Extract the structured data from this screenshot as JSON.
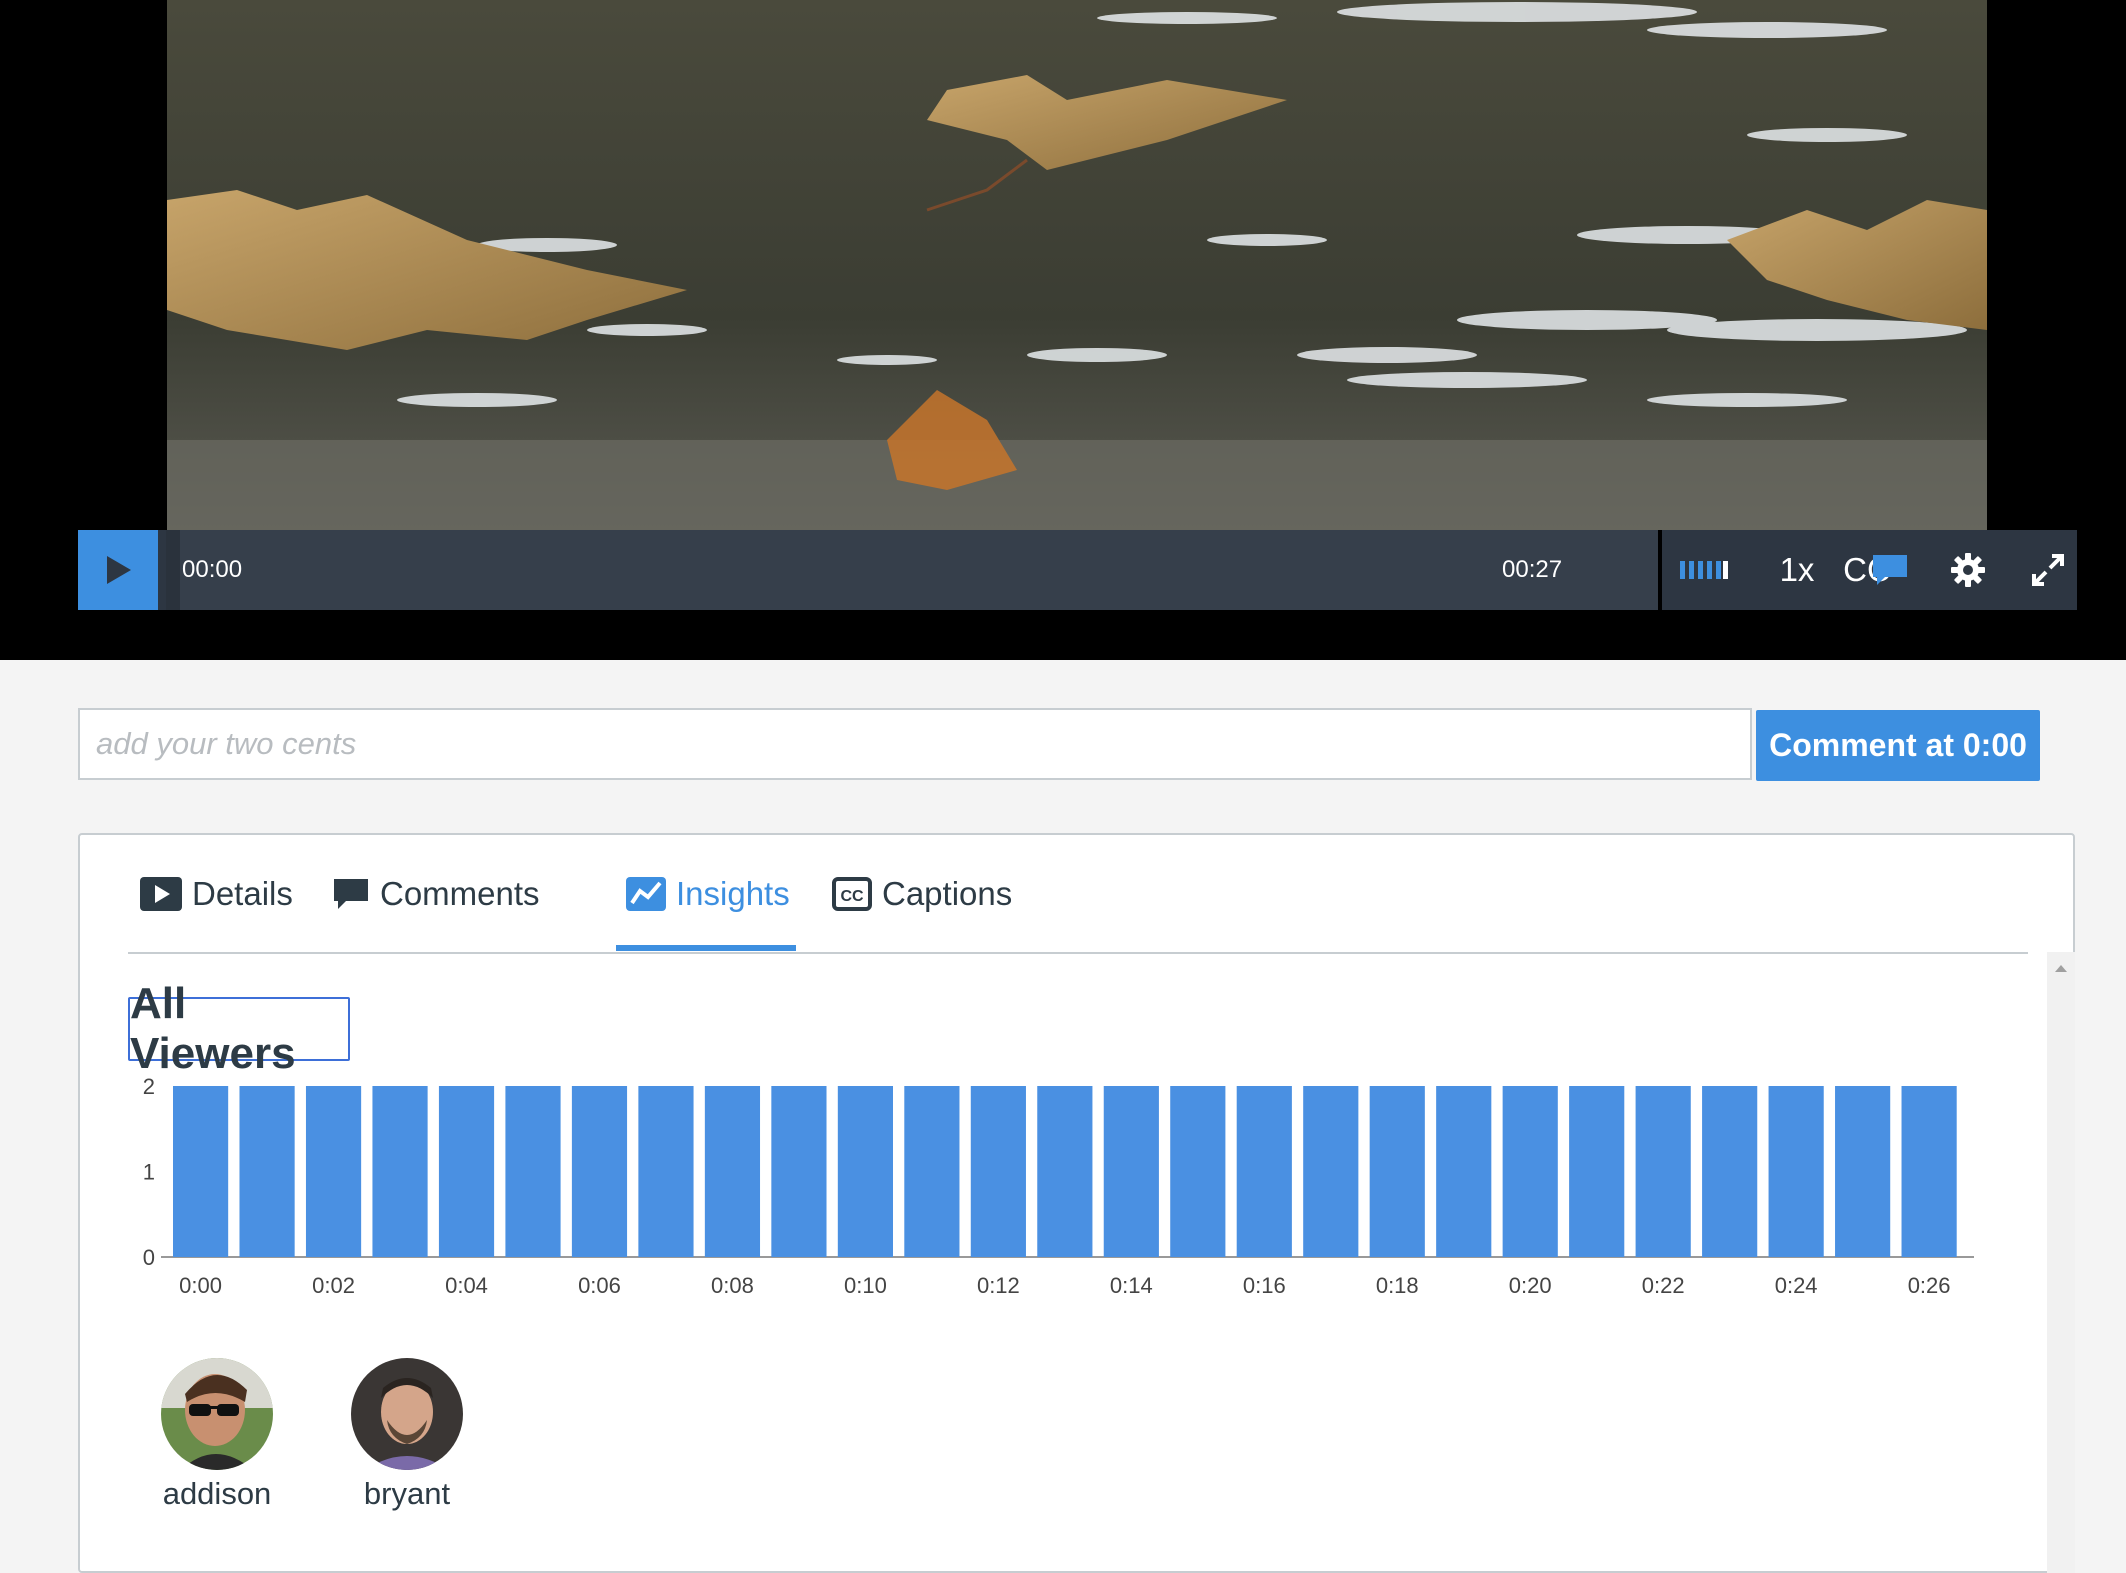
{
  "player": {
    "current_time": "00:00",
    "duration": "00:27",
    "speed_label": "1x",
    "captions_label": "CC",
    "icons": [
      "play-icon",
      "volume-icon",
      "comment-bubble-icon",
      "gear-icon",
      "fullscreen-icon"
    ]
  },
  "comment": {
    "placeholder": "add your two cents",
    "button_label": "Comment at 0:00"
  },
  "tabs": [
    {
      "label": "Details",
      "icon": "video-icon",
      "active": false
    },
    {
      "label": "Comments",
      "icon": "comment-icon",
      "active": false
    },
    {
      "label": "Insights",
      "icon": "chart-line-icon",
      "active": true
    },
    {
      "label": "Captions",
      "icon": "cc-icon",
      "active": false
    }
  ],
  "insights": {
    "heading": "All Viewers"
  },
  "chart_data": {
    "type": "bar",
    "categories": [
      "0:00",
      "0:01",
      "0:02",
      "0:03",
      "0:04",
      "0:05",
      "0:06",
      "0:07",
      "0:08",
      "0:09",
      "0:10",
      "0:11",
      "0:12",
      "0:13",
      "0:14",
      "0:15",
      "0:16",
      "0:17",
      "0:18",
      "0:19",
      "0:20",
      "0:21",
      "0:22",
      "0:23",
      "0:24",
      "0:25",
      "0:26"
    ],
    "x_tick_labels": [
      "0:00",
      "0:02",
      "0:04",
      "0:06",
      "0:08",
      "0:10",
      "0:12",
      "0:14",
      "0:16",
      "0:18",
      "0:20",
      "0:22",
      "0:24",
      "0:26"
    ],
    "values": [
      2,
      2,
      2,
      2,
      2,
      2,
      2,
      2,
      2,
      2,
      2,
      2,
      2,
      2,
      2,
      2,
      2,
      2,
      2,
      2,
      2,
      2,
      2,
      2,
      2,
      2,
      2
    ],
    "y_ticks": [
      0,
      1,
      2
    ],
    "ylim": [
      0,
      2
    ],
    "bar_color": "#4a90e2"
  },
  "viewers": [
    {
      "name": "addison"
    },
    {
      "name": "bryant"
    }
  ],
  "colors": {
    "accent": "#3d8fe0",
    "control_bar": "#2d3642",
    "text": "#2d3b45"
  }
}
